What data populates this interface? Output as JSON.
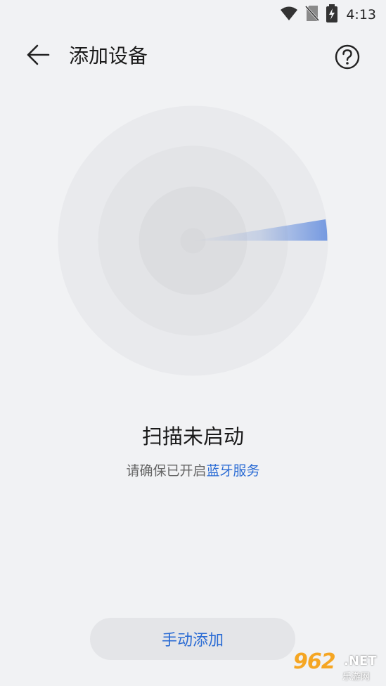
{
  "status_bar": {
    "time": "4:13",
    "icons": [
      "wifi-icon",
      "no-sim-icon",
      "battery-charging-icon"
    ]
  },
  "app_bar": {
    "back_icon": "arrow-left-icon",
    "title": "添加设备",
    "help_icon": "question-circle-icon"
  },
  "radar": {
    "state": "idle",
    "accent_color": "#4f7fdc"
  },
  "scan": {
    "title": "扫描未启动",
    "hint_prefix": "请确保已开启",
    "hint_link": "蓝牙服务"
  },
  "actions": {
    "manual_add_label": "手动添加"
  },
  "watermark": {
    "number": "962",
    "suffix": ".NET",
    "cn": "乐游网"
  },
  "colors": {
    "background": "#f1f2f4",
    "accent": "#2a6bd4",
    "button_bg": "#e4e5e8"
  }
}
